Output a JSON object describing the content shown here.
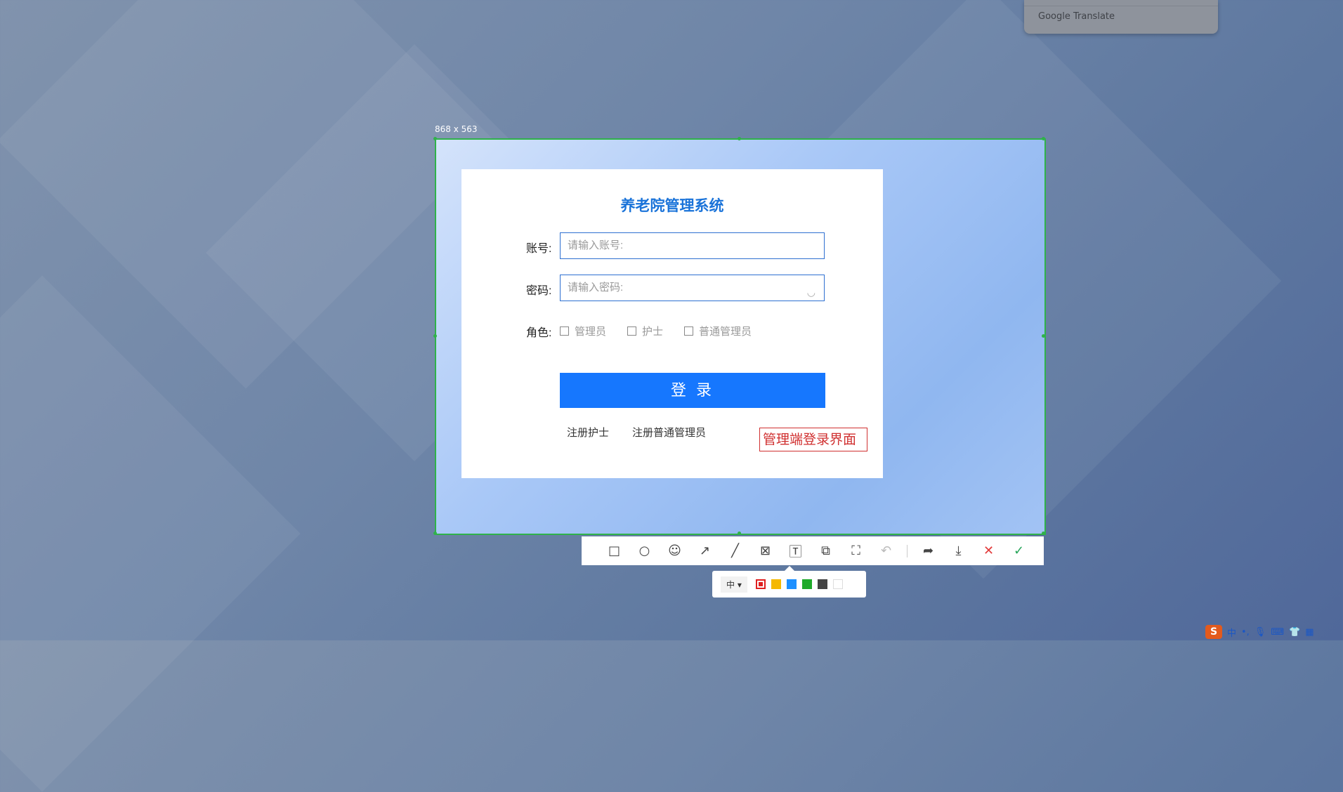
{
  "translate_popup": {
    "brand": "Google Translate"
  },
  "capture": {
    "dimensions_label": "868 x 563"
  },
  "login": {
    "title": "养老院管理系统",
    "account_label": "账号:",
    "account_placeholder": "请输入账号:",
    "password_label": "密码:",
    "password_placeholder": "请输入密码:",
    "role_label": "角色:",
    "roles": [
      "管理员",
      "护士",
      "普通管理员"
    ],
    "login_button": "登 录",
    "register_nurse": "注册护士",
    "register_admin": "注册普通管理员"
  },
  "annotation": {
    "text": "管理端登录界面"
  },
  "toolbar": {
    "tools": [
      "rectangle-icon",
      "ellipse-icon",
      "emoji-icon",
      "arrow-icon",
      "line-icon",
      "mosaic-icon",
      "text-icon",
      "copy-icon",
      "ocr-icon",
      "undo-icon",
      "share-icon",
      "save-icon",
      "cancel-icon",
      "confirm-icon"
    ]
  },
  "subbar": {
    "size_label": "中",
    "colors": [
      "#e02020",
      "#f5b800",
      "#1e90ff",
      "#1faa2a",
      "#444444",
      "#ffffff"
    ]
  },
  "tray": {
    "ime_mode": "中"
  }
}
